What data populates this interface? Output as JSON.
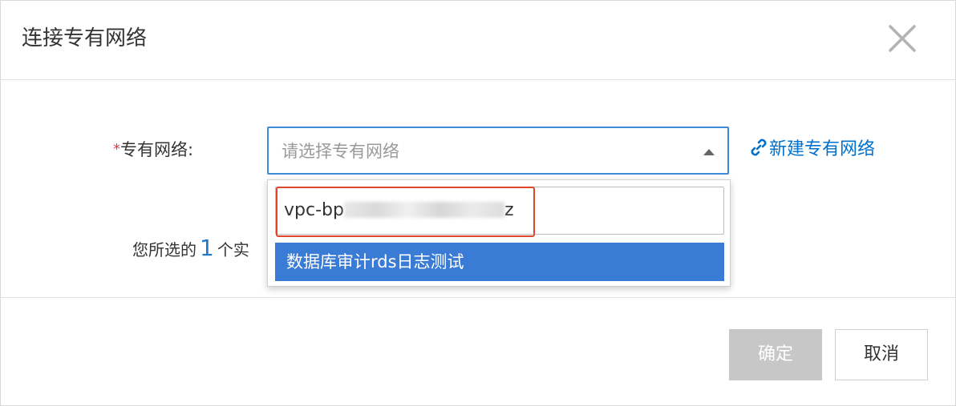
{
  "dialog": {
    "title": "连接专有网络",
    "close_icon": "close-icon"
  },
  "form": {
    "required_mark": "*",
    "vpc_label": "专有网络:",
    "vpc_placeholder": "请选择专有网络",
    "new_vpc_link": "新建专有网络",
    "link_icon": "link-icon"
  },
  "dropdown": {
    "search_value_prefix": "vpc-bp",
    "search_value_suffix": "z",
    "options": [
      {
        "label": "数据库审计rds日志测试",
        "selected": true
      }
    ]
  },
  "selection_note": {
    "prefix": "您所选的",
    "count": "1",
    "suffix": "个实"
  },
  "footer": {
    "ok_label": "确定",
    "cancel_label": "取消"
  },
  "colors": {
    "accent": "#3c8ad9",
    "link": "#0070cc",
    "option_highlight": "#3a7bd5",
    "required": "#e4393c",
    "annotation_frame": "#e3452c",
    "disabled_button": "#c7c7c7"
  }
}
